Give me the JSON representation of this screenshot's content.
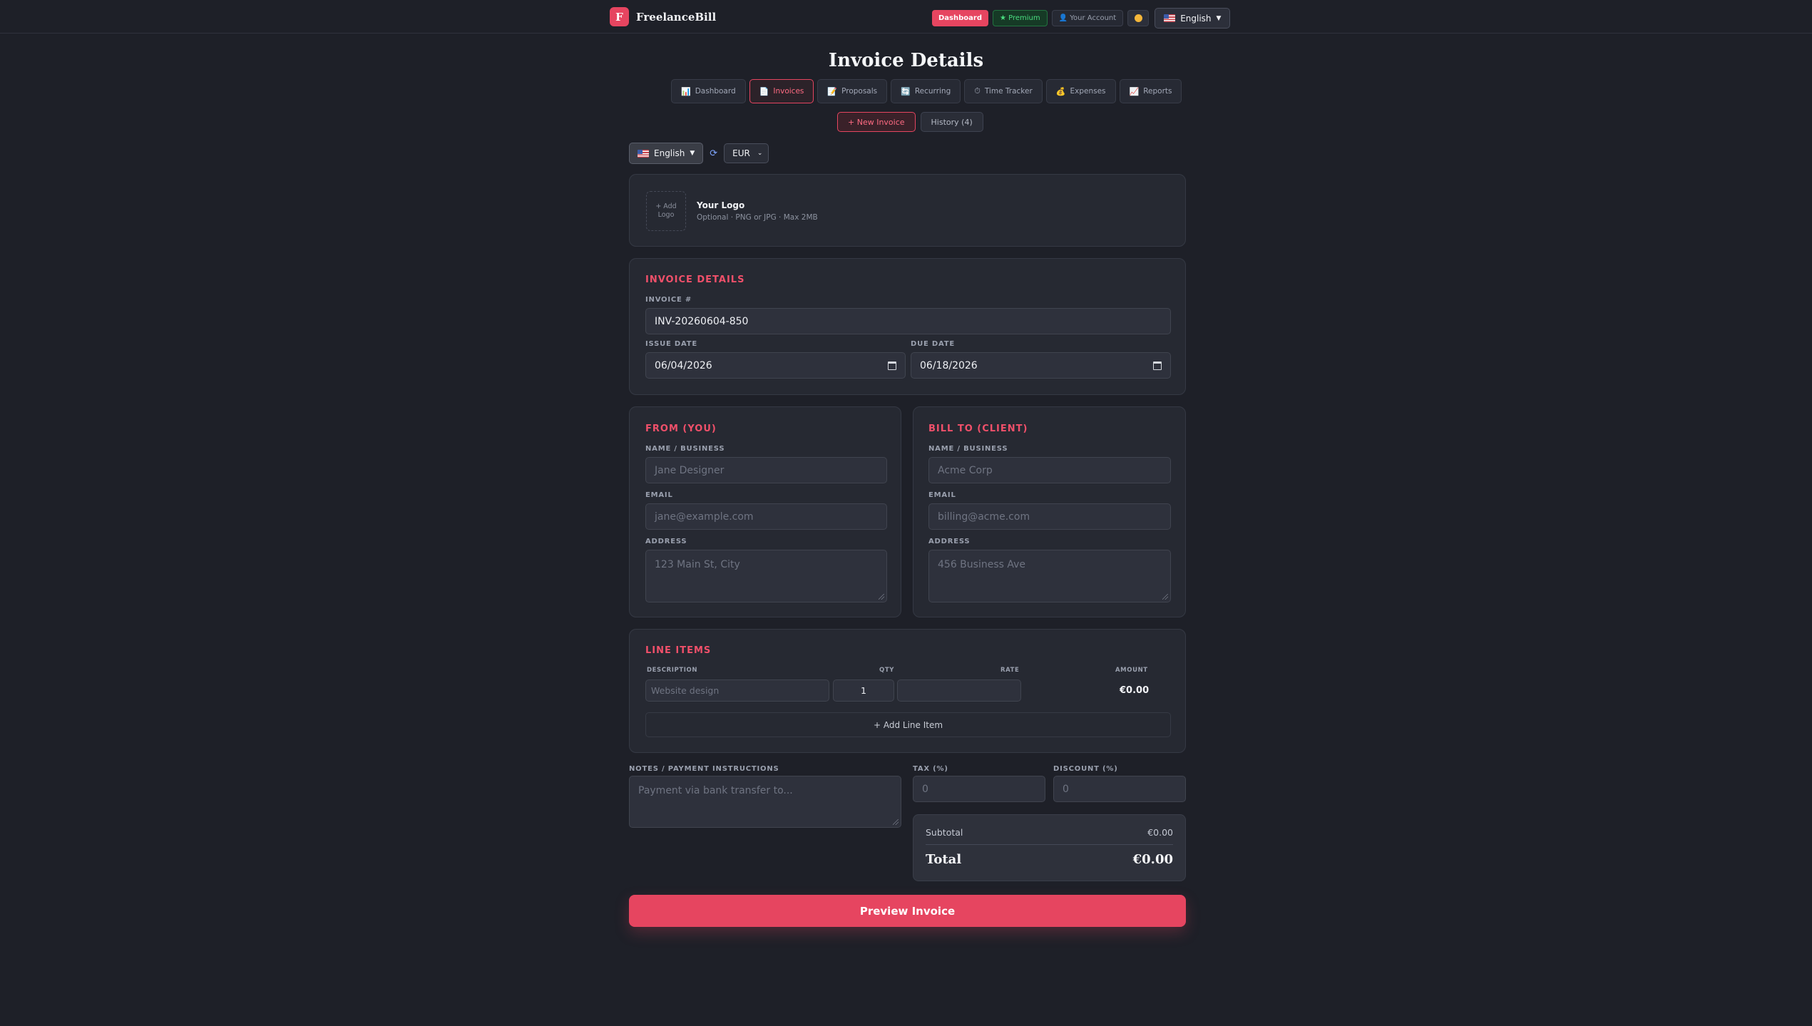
{
  "nav": {
    "brand_letter": "F",
    "brand_name": "FreelanceBill",
    "dashboard": "Dashboard",
    "premium": "★ Premium",
    "account": "👤 Your Account",
    "language": "English"
  },
  "page": {
    "title": "Invoice Details",
    "tabs": [
      {
        "icon": "📊",
        "label": "Dashboard"
      },
      {
        "icon": "📄",
        "label": "Invoices"
      },
      {
        "icon": "📝",
        "label": "Proposals"
      },
      {
        "icon": "🔄",
        "label": "Recurring"
      },
      {
        "icon": "⏱",
        "label": "Time Tracker"
      },
      {
        "icon": "💰",
        "label": "Expenses"
      },
      {
        "icon": "📈",
        "label": "Reports"
      }
    ],
    "new_invoice": "+ New Invoice",
    "history": "History (4)"
  },
  "locale": {
    "language": "English",
    "currency": "EUR"
  },
  "logo": {
    "add_label": "+ Add Logo",
    "title": "Your Logo",
    "hint": "Optional · PNG or JPG · Max 2MB"
  },
  "invoice": {
    "section_title": "INVOICE DETAILS",
    "number_label": "INVOICE #",
    "number_value": "INV-20260604-850",
    "issue_label": "ISSUE DATE",
    "issue_value": "06/04/2026",
    "due_label": "DUE DATE",
    "due_value": "06/18/2026"
  },
  "from": {
    "section_title": "FROM (YOU)",
    "name_label": "NAME / BUSINESS",
    "name_placeholder": "Jane Designer",
    "email_label": "EMAIL",
    "email_placeholder": "jane@example.com",
    "address_label": "ADDRESS",
    "address_placeholder": "123 Main St, City"
  },
  "bill_to": {
    "section_title": "BILL TO (CLIENT)",
    "name_label": "NAME / BUSINESS",
    "name_placeholder": "Acme Corp",
    "email_label": "EMAIL",
    "email_placeholder": "billing@acme.com",
    "address_label": "ADDRESS",
    "address_placeholder": "456 Business Ave"
  },
  "line_items": {
    "section_title": "LINE ITEMS",
    "columns": {
      "description": "DESCRIPTION",
      "qty": "QTY",
      "rate": "RATE",
      "amount": "AMOUNT"
    },
    "rows": [
      {
        "description_placeholder": "Website design",
        "qty": "1",
        "rate": "",
        "amount": "€0.00"
      }
    ],
    "add_label": "+ Add Line Item"
  },
  "extras": {
    "notes_label": "NOTES / PAYMENT INSTRUCTIONS",
    "notes_placeholder": "Payment via bank transfer to...",
    "tax_label": "TAX (%)",
    "tax_placeholder": "0",
    "discount_label": "DISCOUNT (%)",
    "discount_placeholder": "0"
  },
  "totals": {
    "subtotal_label": "Subtotal",
    "subtotal_value": "€0.00",
    "total_label": "Total",
    "total_value": "€0.00"
  },
  "actions": {
    "preview": "Preview Invoice"
  },
  "colors": {
    "accent": "#e64560",
    "background": "#1e2028",
    "card": "#262932",
    "premium": "#4ade80"
  }
}
